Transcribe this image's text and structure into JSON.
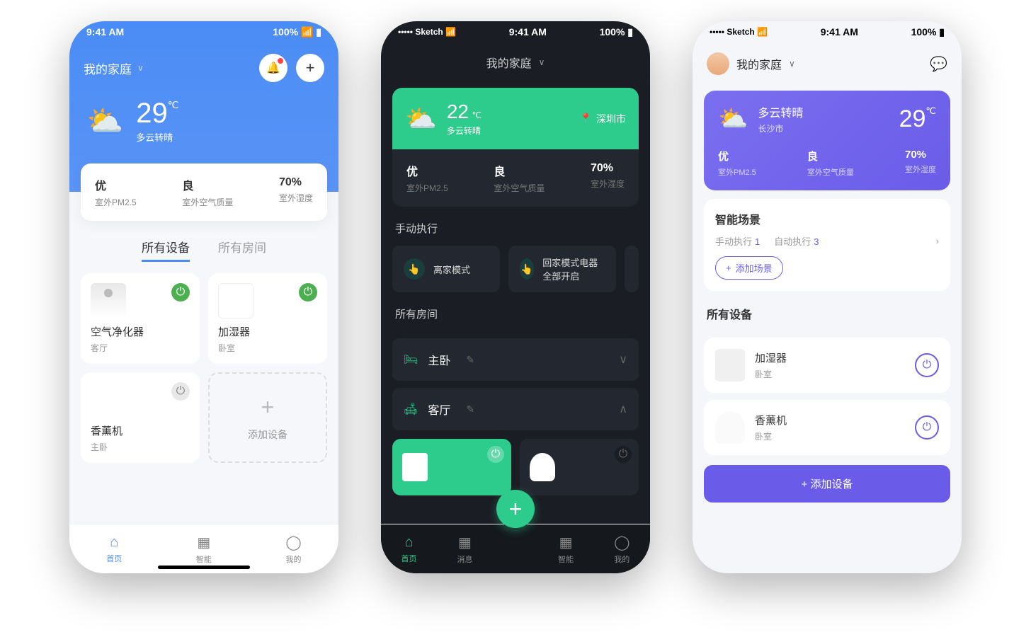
{
  "status": {
    "time": "9:41 AM",
    "battery": "100%",
    "sketch": "Sketch"
  },
  "phone1": {
    "home_label": "我的家庭",
    "temp": "29",
    "temp_unit": "℃",
    "weather_desc": "多云转晴",
    "metrics": [
      {
        "val": "优",
        "lbl": "室外PM2.5"
      },
      {
        "val": "良",
        "lbl": "室外空气质量"
      },
      {
        "val": "70%",
        "lbl": "室外湿度"
      }
    ],
    "tabs": {
      "all_devices": "所有设备",
      "all_rooms": "所有房间"
    },
    "devices": [
      {
        "name": "空气净化器",
        "room": "客厅"
      },
      {
        "name": "加湿器",
        "room": "卧室"
      },
      {
        "name": "香薰机",
        "room": "主卧"
      }
    ],
    "add_device": "添加设备",
    "nav": {
      "home": "首页",
      "smart": "智能",
      "me": "我的"
    }
  },
  "phone2": {
    "home_label": "我的家庭",
    "temp": "22",
    "temp_unit": "℃",
    "weather_desc": "多云转晴",
    "city": "深圳市",
    "metrics": [
      {
        "val": "优",
        "lbl": "室外PM2.5"
      },
      {
        "val": "良",
        "lbl": "室外空气质量"
      },
      {
        "val": "70%",
        "lbl": "室外湿度"
      }
    ],
    "manual_exec": "手动执行",
    "scenes": [
      {
        "name": "离家模式"
      },
      {
        "name": "回家模式电器全部开启"
      }
    ],
    "all_rooms": "所有房间",
    "rooms": [
      {
        "name": "主卧"
      },
      {
        "name": "客厅"
      }
    ],
    "nav": {
      "home": "首页",
      "messages": "消息",
      "smart": "智能",
      "me": "我的"
    }
  },
  "phone3": {
    "home_label": "我的家庭",
    "weather_desc": "多云转晴",
    "city": "长沙市",
    "temp": "29",
    "temp_unit": "℃",
    "metrics": [
      {
        "val": "优",
        "lbl": "室外PM2.5"
      },
      {
        "val": "良",
        "lbl": "室外空气质量"
      },
      {
        "val": "70%",
        "lbl": "室外湿度"
      }
    ],
    "scene_title": "智能场景",
    "manual_label": "手动执行",
    "manual_count": "1",
    "auto_label": "自动执行",
    "auto_count": "3",
    "add_scene": "添加场景",
    "all_devices": "所有设备",
    "devices": [
      {
        "name": "加湿器",
        "room": "卧室"
      },
      {
        "name": "香薰机",
        "room": "卧室"
      }
    ],
    "add_device": "添加设备"
  }
}
